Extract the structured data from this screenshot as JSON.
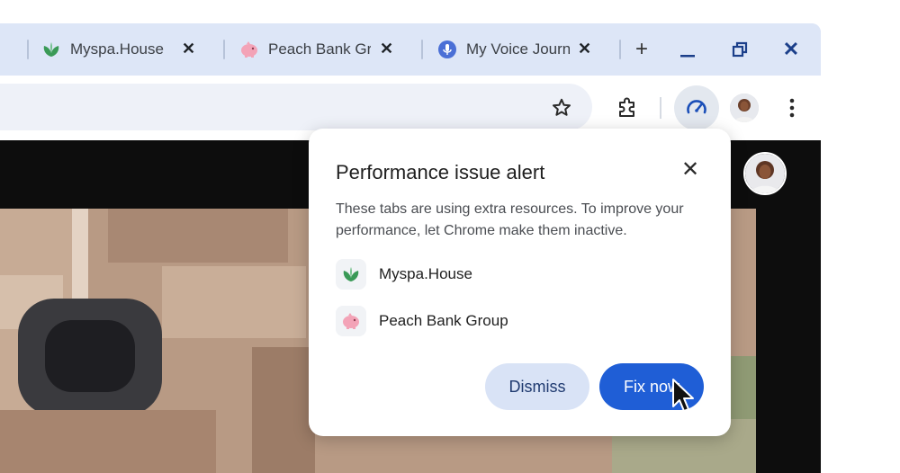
{
  "tabs": [
    {
      "title": "Myspa.House",
      "icon": "leaf-icon"
    },
    {
      "title": "Peach Bank Gr",
      "icon": "piggy-bank-icon"
    },
    {
      "title": "My Voice Journ",
      "icon": "microphone-icon"
    }
  ],
  "tab_close": "✕",
  "window_controls": {
    "new_tab": "+",
    "minimize": "minimize-icon",
    "restore": "restore-icon",
    "close": "✕"
  },
  "toolbar_icons": [
    "star-icon",
    "extensions-icon",
    "performance-icon",
    "profile-avatar",
    "more-icon"
  ],
  "popup": {
    "title": "Performance issue alert",
    "close": "✕",
    "description": "These tabs are using extra resources. To improve your performance, let Chrome make them inactive.",
    "sites": [
      {
        "name": "Myspa.House",
        "icon": "leaf-icon"
      },
      {
        "name": "Peach Bank Group",
        "icon": "piggy-bank-icon"
      }
    ],
    "dismiss_label": "Dismiss",
    "fix_label": "Fix now"
  },
  "colors": {
    "accent": "#1f5ed6",
    "tabstrip": "#dde6f7",
    "dismiss_bg": "#d9e3f6"
  }
}
